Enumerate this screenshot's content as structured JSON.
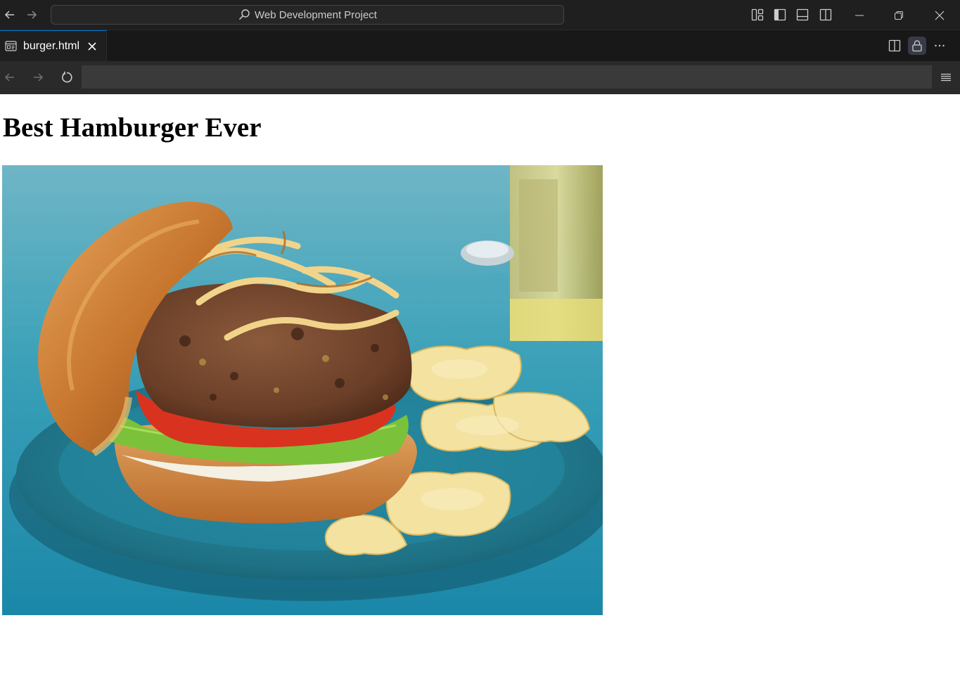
{
  "window": {
    "search_text": "Web Development Project"
  },
  "tabs": [
    {
      "label": "burger.html",
      "icon": "preview-icon",
      "active": true
    }
  ],
  "browser": {
    "url": ""
  },
  "page": {
    "heading": "Best Hamburger Ever",
    "image": {
      "subject": "hamburger-photo",
      "alt": ""
    }
  },
  "colors": {
    "titlebar_bg": "#1f1f1f",
    "accent": "#0078d4",
    "toolbar_bg": "#2a2a2a",
    "page_bg": "#ffffff"
  }
}
